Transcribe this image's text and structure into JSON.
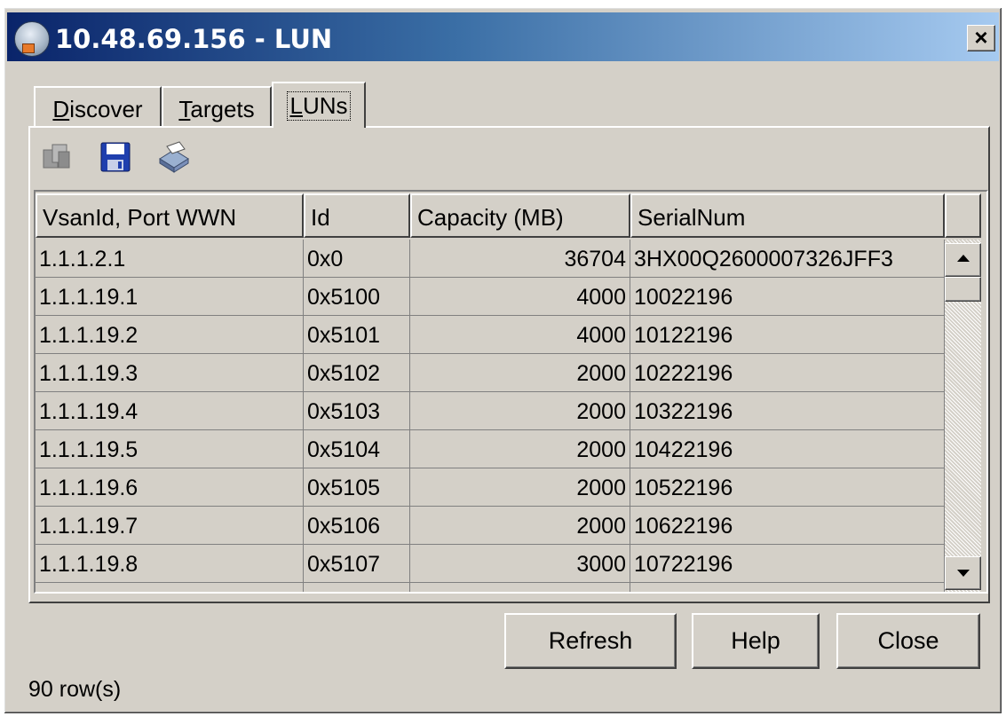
{
  "window": {
    "title": "10.48.69.156 - LUN"
  },
  "tabs": [
    {
      "label_prefix": "",
      "mnemonic": "D",
      "label_rest": "iscover",
      "active": false
    },
    {
      "label_prefix": "",
      "mnemonic": "T",
      "label_rest": "argets",
      "active": false
    },
    {
      "label_prefix": "",
      "mnemonic": "L",
      "label_rest": "UNs",
      "active": true
    }
  ],
  "toolbar": {
    "icons": [
      "copy-icon",
      "save-icon",
      "print-icon"
    ]
  },
  "table": {
    "columns": [
      "VsanId, Port WWN",
      "Id",
      "Capacity (MB)",
      "SerialNum"
    ],
    "rows": [
      [
        "1.1.1.2.1",
        "0x0",
        "36704",
        "3HX00Q2600007326JFF3"
      ],
      [
        "1.1.1.19.1",
        "0x5100",
        "4000",
        "10022196"
      ],
      [
        "1.1.1.19.2",
        "0x5101",
        "4000",
        "10122196"
      ],
      [
        "1.1.1.19.3",
        "0x5102",
        "2000",
        "10222196"
      ],
      [
        "1.1.1.19.4",
        "0x5103",
        "2000",
        "10322196"
      ],
      [
        "1.1.1.19.5",
        "0x5104",
        "2000",
        "10422196"
      ],
      [
        "1.1.1.19.6",
        "0x5105",
        "2000",
        "10522196"
      ],
      [
        "1.1.1.19.7",
        "0x5106",
        "2000",
        "10622196"
      ],
      [
        "1.1.1.19.8",
        "0x5107",
        "3000",
        "10722196"
      ],
      [
        "",
        "",
        "",
        ""
      ]
    ]
  },
  "buttons": {
    "refresh": "Refresh",
    "help": "Help",
    "close": "Close"
  },
  "status": {
    "row_count": "90 row(s)"
  },
  "colors": {
    "title_start": "#0a246a",
    "title_end": "#a6caf0",
    "face": "#d4d0c8"
  }
}
